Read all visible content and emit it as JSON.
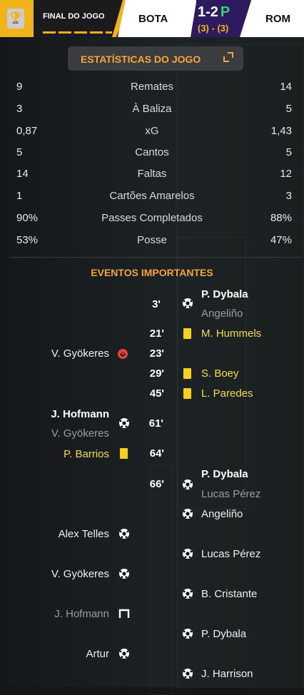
{
  "header": {
    "status": "FINAL DO JOGO",
    "home_team": "BOTA",
    "away_team": "ROM",
    "score": "1-2",
    "score_suffix": "P",
    "penalties": "(3) - (3)"
  },
  "stats": {
    "title": "ESTATÍSTICAS DO JOGO",
    "rows": [
      {
        "label": "Remates",
        "home": "9",
        "away": "14"
      },
      {
        "label": "À Baliza",
        "home": "3",
        "away": "5"
      },
      {
        "label": "xG",
        "home": "0,87",
        "away": "1,43"
      },
      {
        "label": "Cantos",
        "home": "5",
        "away": "5"
      },
      {
        "label": "Faltas",
        "home": "14",
        "away": "12"
      },
      {
        "label": "Cartões Amarelos",
        "home": "1",
        "away": "3"
      },
      {
        "label": "Passes Completados",
        "home": "90%",
        "away": "88%"
      },
      {
        "label": "Posse",
        "home": "53%",
        "away": "47%"
      }
    ]
  },
  "events": {
    "title": "EVENTOS IMPORTANTES",
    "minutes": [
      "3'",
      "21'",
      "23'",
      "29'",
      "45'",
      "61'",
      "64'",
      "66'"
    ],
    "away": [
      {
        "text": "P. Dybala"
      },
      {
        "text": "Angeliño"
      },
      {
        "text": "M. Hummels"
      },
      {
        "text": "S. Boey"
      },
      {
        "text": "L. Paredes"
      },
      {
        "text": "P. Dybala"
      },
      {
        "text": "Lucas Pérez"
      },
      {
        "text": "Angeliño"
      },
      {
        "text": "Lucas Pérez"
      },
      {
        "text": "B. Cristante"
      },
      {
        "text": "P. Dybala"
      },
      {
        "text": "J. Harrison"
      }
    ],
    "home": [
      {
        "text": "V. Gyökeres"
      },
      {
        "text": "J. Hofmann"
      },
      {
        "text": "V. Gyökeres"
      },
      {
        "text": "P. Barrios"
      },
      {
        "text": "Alex Telles"
      },
      {
        "text": "V. Gyökeres"
      },
      {
        "text": "J. Hofmann"
      },
      {
        "text": "Artur"
      }
    ]
  },
  "colors": {
    "accent": "#f5a63b",
    "yellow_card": "#f2d21a",
    "home_brand": "#f0b31a",
    "away_brand": "#2e1a5e"
  }
}
